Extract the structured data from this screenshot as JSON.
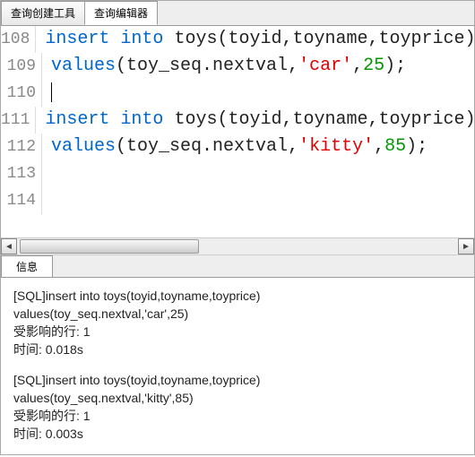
{
  "tabs": {
    "query_builder": "查询创建工具",
    "query_editor": "查询编辑器"
  },
  "editor": {
    "lines": [
      {
        "num": "108",
        "tokens": [
          {
            "t": "kw",
            "v": "insert into"
          },
          {
            "t": "sp",
            "v": " "
          },
          {
            "t": "ident",
            "v": "toys"
          },
          {
            "t": "punct",
            "v": "("
          },
          {
            "t": "ident",
            "v": "toyid"
          },
          {
            "t": "punct",
            "v": ","
          },
          {
            "t": "ident",
            "v": "toyname"
          },
          {
            "t": "punct",
            "v": ","
          },
          {
            "t": "ident",
            "v": "toyprice"
          },
          {
            "t": "punct",
            "v": ")"
          }
        ]
      },
      {
        "num": "109",
        "tokens": [
          {
            "t": "kw",
            "v": "values"
          },
          {
            "t": "punct",
            "v": "("
          },
          {
            "t": "ident",
            "v": "toy_seq.nextval"
          },
          {
            "t": "punct",
            "v": ","
          },
          {
            "t": "str",
            "v": "'car'"
          },
          {
            "t": "punct",
            "v": ","
          },
          {
            "t": "num",
            "v": "25"
          },
          {
            "t": "punct",
            "v": ");"
          }
        ]
      },
      {
        "num": "110",
        "tokens": [
          {
            "t": "cursor",
            "v": ""
          }
        ]
      },
      {
        "num": "111",
        "tokens": [
          {
            "t": "kw",
            "v": "insert into"
          },
          {
            "t": "sp",
            "v": " "
          },
          {
            "t": "ident",
            "v": "toys"
          },
          {
            "t": "punct",
            "v": "("
          },
          {
            "t": "ident",
            "v": "toyid"
          },
          {
            "t": "punct",
            "v": ","
          },
          {
            "t": "ident",
            "v": "toyname"
          },
          {
            "t": "punct",
            "v": ","
          },
          {
            "t": "ident",
            "v": "toyprice"
          },
          {
            "t": "punct",
            "v": ")"
          }
        ]
      },
      {
        "num": "112",
        "tokens": [
          {
            "t": "kw",
            "v": "values"
          },
          {
            "t": "punct",
            "v": "("
          },
          {
            "t": "ident",
            "v": "toy_seq.nextval"
          },
          {
            "t": "punct",
            "v": ","
          },
          {
            "t": "str",
            "v": "'kitty'"
          },
          {
            "t": "punct",
            "v": ","
          },
          {
            "t": "num",
            "v": "85"
          },
          {
            "t": "punct",
            "v": ");"
          }
        ]
      },
      {
        "num": "113",
        "tokens": []
      },
      {
        "num": "114",
        "tokens": []
      }
    ]
  },
  "bottom_tab": {
    "label": "信息"
  },
  "results": {
    "blocks": [
      {
        "sql1": "[SQL]insert into toys(toyid,toyname,toyprice)",
        "sql2": "values(toy_seq.nextval,'car',25)",
        "affected": "受影响的行: 1",
        "time": "时间: 0.018s"
      },
      {
        "sql1": "[SQL]insert into toys(toyid,toyname,toyprice)",
        "sql2": "values(toy_seq.nextval,'kitty',85)",
        "affected": "受影响的行: 1",
        "time": "时间: 0.003s"
      }
    ]
  }
}
